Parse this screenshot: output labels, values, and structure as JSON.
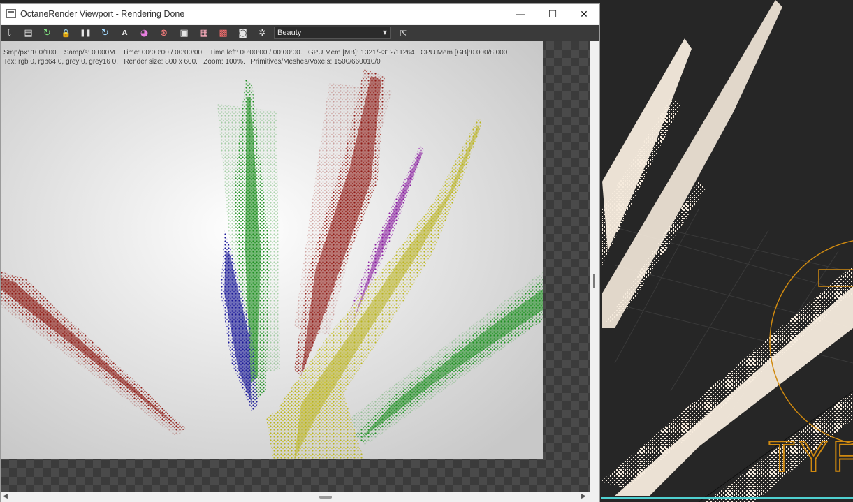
{
  "window": {
    "title": "OctaneRender Viewport - Rendering Done",
    "minimize_glyph": "—",
    "maximize_glyph": "☐",
    "close_glyph": "✕"
  },
  "toolbar": {
    "pass_select_value": "Beauty",
    "buttons": [
      {
        "name": "import-icon",
        "glyph": "⇩"
      },
      {
        "name": "clipboard-icon",
        "glyph": "▤"
      },
      {
        "name": "restart-icon",
        "glyph": "↻"
      },
      {
        "name": "lock-icon",
        "glyph": "🔒"
      },
      {
        "name": "pause-icon",
        "glyph": "❚❚"
      },
      {
        "name": "refresh-icon",
        "glyph": "↻"
      },
      {
        "name": "aperture-icon",
        "glyph": "A"
      },
      {
        "name": "color-wheel-icon",
        "glyph": "◕"
      },
      {
        "name": "target-icon",
        "glyph": "⊛"
      },
      {
        "name": "region-icon",
        "glyph": "▣"
      },
      {
        "name": "film-region-icon",
        "glyph": "▦"
      },
      {
        "name": "render-icon",
        "glyph": "▩"
      },
      {
        "name": "camera-icon",
        "glyph": "◙"
      },
      {
        "name": "settings-icon",
        "glyph": "✲"
      }
    ],
    "fit_glyph": "⇱"
  },
  "stats": {
    "line1": "Smp/px: 100/100.   Samp/s: 0.000M.   Time: 00:00:00 / 00:00:00.   Time left: 00:00:00 / 00:00:00.   GPU Mem [MB]: 1321/9312/11264   CPU Mem [GB]:0.000/8.000",
    "line2": "Tex: rgb 0, rgb64 0, grey 0, grey16 0.   Render size: 800 x 600.   Zoom: 100%.   Primitives/Meshes/Voxels: 1500/660010/0"
  },
  "background_viewport": {
    "label": "TYF"
  },
  "colors": {
    "particle_red": "#8e1a14",
    "particle_green": "#1f8f22",
    "particle_blue": "#1c1a98",
    "particle_purple": "#8a1fa0",
    "particle_yellow": "#b9b320",
    "particle_white": "#f6ebdd",
    "viewport_grid": "#3a3a3a",
    "selection_orange": "#d08a10",
    "accent_teal": "#4fd0d0"
  }
}
